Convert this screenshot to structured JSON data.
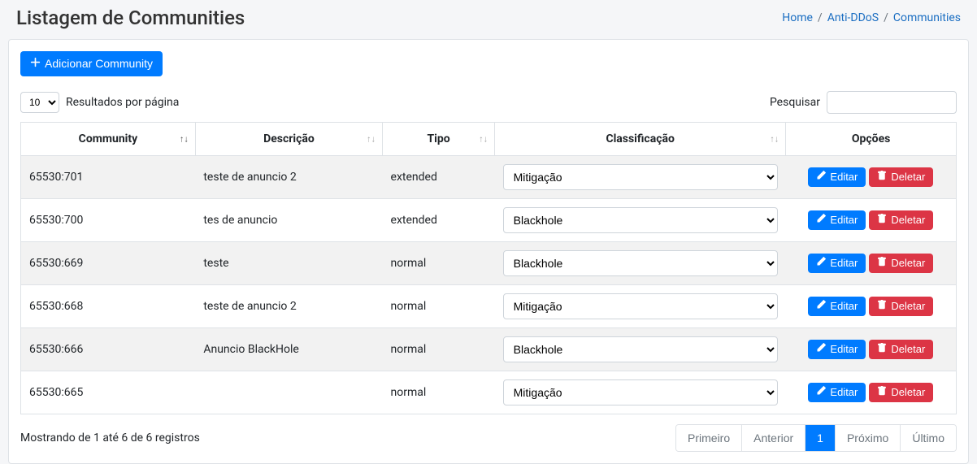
{
  "header": {
    "title": "Listagem de Communities",
    "breadcrumb": [
      {
        "label": "Home"
      },
      {
        "label": "Anti-DDoS"
      },
      {
        "label": "Communities"
      }
    ]
  },
  "toolbar": {
    "add_label": "Adicionar Community"
  },
  "datatable": {
    "length_value": "10",
    "length_label": "Resultados por página",
    "search_label": "Pesquisar",
    "search_value": "",
    "columns": {
      "community": "Community",
      "descricao": "Descrição",
      "tipo": "Tipo",
      "classificacao": "Classificação",
      "opcoes": "Opções"
    },
    "classif_options": [
      "Mitigação",
      "Blackhole"
    ],
    "rows": [
      {
        "community": "65530:701",
        "descricao": "teste de anuncio 2",
        "tipo": "extended",
        "classificacao": "Mitigação"
      },
      {
        "community": "65530:700",
        "descricao": "tes de anuncio",
        "tipo": "extended",
        "classificacao": "Blackhole"
      },
      {
        "community": "65530:669",
        "descricao": "teste",
        "tipo": "normal",
        "classificacao": "Blackhole"
      },
      {
        "community": "65530:668",
        "descricao": "teste de anuncio 2",
        "tipo": "normal",
        "classificacao": "Mitigação"
      },
      {
        "community": "65530:666",
        "descricao": "Anuncio BlackHole",
        "tipo": "normal",
        "classificacao": "Blackhole"
      },
      {
        "community": "65530:665",
        "descricao": "",
        "tipo": "normal",
        "classificacao": "Mitigação"
      }
    ],
    "actions": {
      "edit": "Editar",
      "delete": "Deletar"
    },
    "info": "Mostrando de 1 até 6 de 6 registros",
    "pagination": {
      "first": "Primeiro",
      "prev": "Anterior",
      "page": "1",
      "next": "Próximo",
      "last": "Último"
    }
  }
}
